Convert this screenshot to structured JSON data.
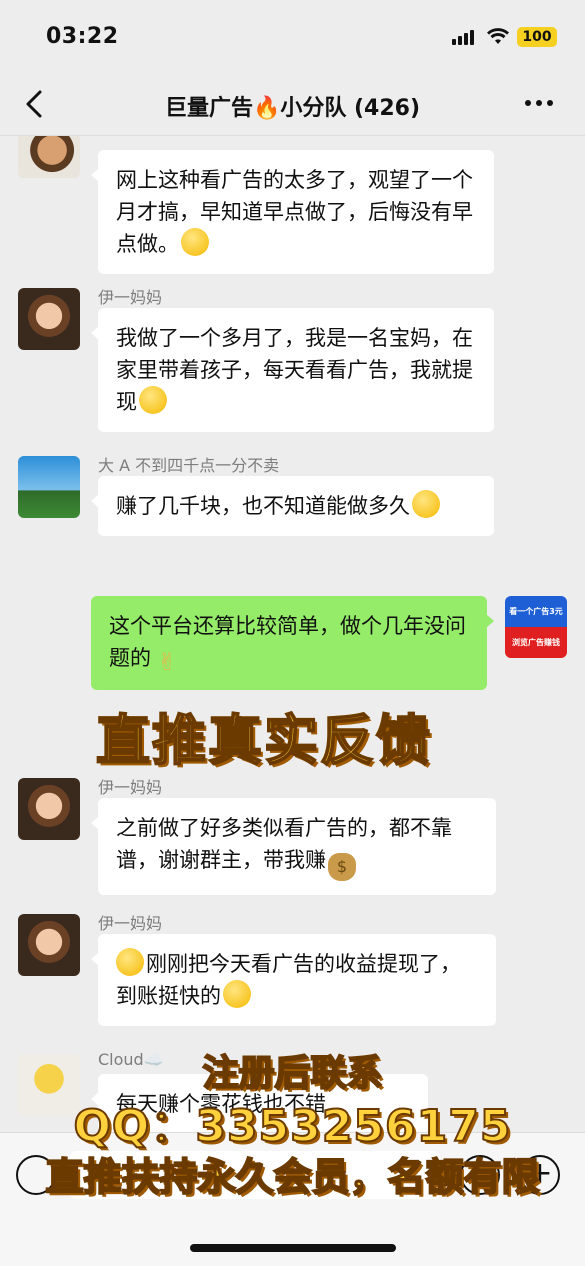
{
  "status": {
    "time": "03:22",
    "battery": "100"
  },
  "nav": {
    "title": "巨量广告🔥小分队 (426)"
  },
  "messages": [
    {
      "sender": "",
      "text": "网上这种看广告的太多了，观望了一个月才搞，早知道早点做了，后悔没有早点做。",
      "emoji": "sweat-smile-emoji"
    },
    {
      "sender": "伊一妈妈",
      "text": "我做了一个多月了，我是一名宝妈，在家里带着孩子，每天看看广告，我就提现",
      "emoji": "thinking-emoji"
    },
    {
      "sender": "大 A 不到四千点一分不卖",
      "text": "赚了几千块，也不知道能做多久",
      "emoji": "grin-emoji"
    },
    {
      "sender": "",
      "text": "这个平台还算比较简单，做个几年没问题的",
      "emoji": "victory-hand-emoji"
    },
    {
      "sender": "伊一妈妈",
      "text": "之前做了好多类似看广告的，都不靠谱，谢谢群主，带我赚",
      "emoji": "money-bag-emoji"
    },
    {
      "sender": "伊一妈妈",
      "text": "刚刚把今天看广告的收益提现了，到账挺快的",
      "emoji_lead": "grin-emoji",
      "emoji": "grin-emoji"
    },
    {
      "sender": "Cloud☁️",
      "text": "每天赚个零花钱也不错"
    }
  ],
  "ad_tag": {
    "line1": "看一个广告3元",
    "line2": "浏览广告赚钱"
  },
  "banner": {
    "text": "直推真实反馈"
  },
  "overlay": {
    "line1": "注册后联系",
    "line2": "QQ：3353256175",
    "line3": "直推扶持永久会员，名额有限"
  }
}
